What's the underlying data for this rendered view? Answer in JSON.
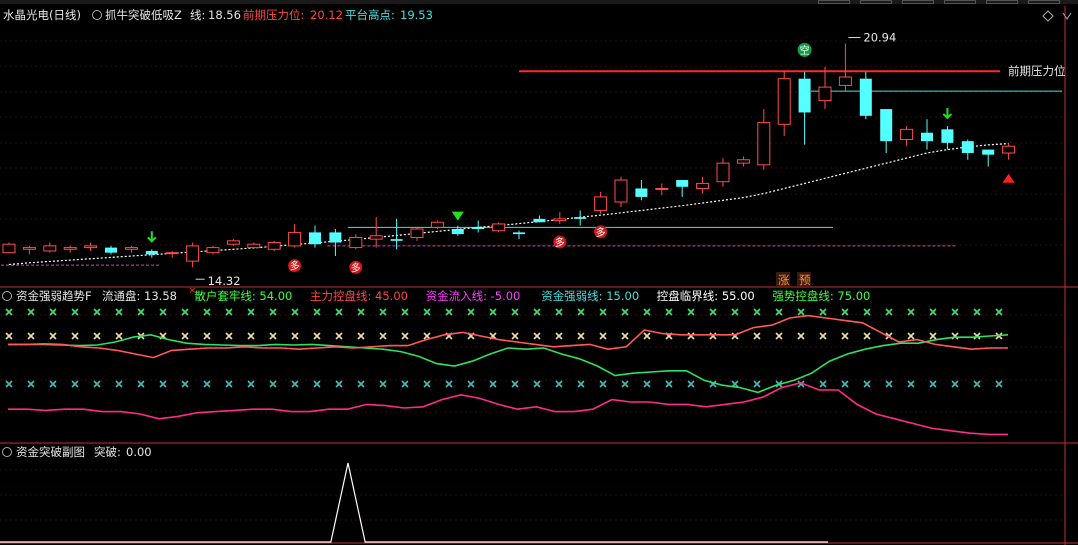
{
  "main": {
    "stock": "水晶光电(日线)",
    "indicator": "抓牛突破低吸Z",
    "line_label": "线:",
    "line_value": "18.56",
    "resist_label": "前期压力位:",
    "resist_value": "20.12",
    "platform_label": "平台高点:",
    "platform_value": "19.53",
    "resist_line_text": "前期压力位",
    "high_text": "20.94",
    "low_text": "14.32",
    "tag_duo": "多",
    "tag_kong": "空",
    "tag_zhang": "涨",
    "tag_yu": "预"
  },
  "sub1": {
    "title": "资金强弱趋势F",
    "items": [
      {
        "label": "流通盘:",
        "value": "13.58",
        "color": "#e6e6e6"
      },
      {
        "label": "散户套牢线:",
        "value": "54.00",
        "color": "#3cff3c"
      },
      {
        "label": "主力控盘线:",
        "value": "45.00",
        "color": "#ff4444"
      },
      {
        "label": "资金流入线:",
        "value": "-5.00",
        "color": "#ff3cff"
      },
      {
        "label": "资金强弱线:",
        "value": "15.00",
        "color": "#40e0e0"
      },
      {
        "label": "控盘临界线:",
        "value": "55.00",
        "color": "#ffffff"
      },
      {
        "label": "强势控盘线:",
        "value": "75.00",
        "color": "#3cff3c"
      }
    ]
  },
  "sub2": {
    "title": "资金突破副图",
    "label": "突破:",
    "value": "0.00"
  },
  "colors": {
    "up": "#ff4b4b",
    "down": "#54ffff",
    "resist": "#ff2b2b",
    "platform": "#40e0e0",
    "ma": "#ffffff",
    "sanhu": "#30e060",
    "zhuli": "#ff5a5a",
    "inflow": "#ff2b8a"
  },
  "chart_data": [
    {
      "type": "candlestick",
      "x": [
        0,
        1,
        2,
        3,
        4,
        5,
        6,
        7,
        8,
        9,
        10,
        11,
        12,
        13,
        14,
        15,
        16,
        17,
        18,
        19,
        20,
        21,
        22,
        23,
        24,
        25,
        26,
        27,
        28,
        29,
        30,
        31,
        32,
        33,
        34,
        35,
        36,
        37,
        38,
        39,
        40,
        41,
        42,
        43,
        44,
        45,
        46,
        47,
        48,
        49
      ],
      "open": [
        14.75,
        14.85,
        14.8,
        14.85,
        14.9,
        14.9,
        14.85,
        14.8,
        14.75,
        14.5,
        14.75,
        15.0,
        14.9,
        14.85,
        14.95,
        15.35,
        15.35,
        14.9,
        15.15,
        15.15,
        15.2,
        15.5,
        15.45,
        15.5,
        15.4,
        15.35,
        15.75,
        15.7,
        15.8,
        16.0,
        16.25,
        16.65,
        16.65,
        16.9,
        16.65,
        16.85,
        17.4,
        17.35,
        18.55,
        19.9,
        19.25,
        19.7,
        19.9,
        19.0,
        18.1,
        18.3,
        18.4,
        18.05,
        17.8,
        17.7
      ],
      "close": [
        15.0,
        14.9,
        14.95,
        14.9,
        14.95,
        14.75,
        14.9,
        14.7,
        14.75,
        14.95,
        14.9,
        15.1,
        15.0,
        15.05,
        15.35,
        15.0,
        15.05,
        15.2,
        15.25,
        15.1,
        15.45,
        15.65,
        15.3,
        15.45,
        15.6,
        15.3,
        15.65,
        15.75,
        15.75,
        16.4,
        16.9,
        16.4,
        16.65,
        16.7,
        16.8,
        17.4,
        17.5,
        18.6,
        19.9,
        18.9,
        19.65,
        19.95,
        18.8,
        18.05,
        18.4,
        18.05,
        18.0,
        17.7,
        17.65,
        17.9
      ],
      "high": [
        15.05,
        14.95,
        15.05,
        14.95,
        15.05,
        14.95,
        14.95,
        14.85,
        14.8,
        15.05,
        14.95,
        15.15,
        15.05,
        15.1,
        15.6,
        15.55,
        15.45,
        15.3,
        15.8,
        15.75,
        15.5,
        15.7,
        15.55,
        15.7,
        15.65,
        15.4,
        15.85,
        15.95,
        16.0,
        16.55,
        17.0,
        16.9,
        16.8,
        16.85,
        17.0,
        17.55,
        17.6,
        19.0,
        20.12,
        20.1,
        20.25,
        20.94,
        20.1,
        18.3,
        18.5,
        18.7,
        18.5,
        18.1,
        17.8,
        18.0
      ],
      "low": [
        14.75,
        14.7,
        14.75,
        14.75,
        14.8,
        14.7,
        14.75,
        14.6,
        14.6,
        14.32,
        14.7,
        14.95,
        14.85,
        14.8,
        14.9,
        14.9,
        14.65,
        14.85,
        14.9,
        14.85,
        15.1,
        15.45,
        15.25,
        15.35,
        15.35,
        15.15,
        15.65,
        15.6,
        15.55,
        15.9,
        16.1,
        16.3,
        16.45,
        16.4,
        16.5,
        16.7,
        17.3,
        17.2,
        18.2,
        17.95,
        19.0,
        19.55,
        18.7,
        17.7,
        17.9,
        17.8,
        17.8,
        17.5,
        17.3,
        17.5
      ],
      "ma": [
        14.4,
        14.45,
        14.49,
        14.53,
        14.57,
        14.61,
        14.65,
        14.69,
        14.73,
        14.77,
        14.81,
        14.85,
        14.89,
        14.94,
        14.99,
        15.04,
        15.09,
        15.14,
        15.2,
        15.26,
        15.32,
        15.38,
        15.44,
        15.5,
        15.55,
        15.61,
        15.67,
        15.73,
        15.8,
        15.86,
        15.93,
        16.0,
        16.07,
        16.14,
        16.22,
        16.3,
        16.38,
        16.5,
        16.65,
        16.8,
        16.95,
        17.1,
        17.25,
        17.4,
        17.55,
        17.7,
        17.8,
        17.88,
        17.94,
        17.98
      ],
      "resist_line": {
        "value": 20.12,
        "from": 25,
        "to": 49
      },
      "platform_line_1": {
        "value": 19.53,
        "from": 40,
        "to": 49
      },
      "platform_line_2": {
        "value": 15.5,
        "from": 17,
        "to": 40
      },
      "magenta_line_1": {
        "value": 14.38,
        "from": 0,
        "to": 7
      },
      "magenta_line_2": {
        "value": 14.95,
        "from": 16,
        "to": 46
      },
      "duo_marks": [
        14,
        17,
        27,
        29
      ],
      "green_arrows": [
        7,
        46
      ],
      "green_tri": [
        22
      ],
      "red_tri": [
        49
      ],
      "kong_mark": [
        39
      ],
      "high_index": 41,
      "low_index": 9,
      "ylim": [
        14.0,
        21.4
      ]
    },
    {
      "type": "line",
      "x": [
        0,
        1,
        2,
        3,
        4,
        5,
        6,
        7,
        8,
        9,
        10,
        11,
        12,
        13,
        14,
        15,
        16,
        17,
        18,
        19,
        20,
        21,
        22,
        23,
        24,
        25,
        26,
        27,
        28,
        29,
        30,
        31,
        32,
        33,
        34,
        35,
        36,
        37,
        38,
        39,
        40,
        41,
        42,
        43,
        44,
        45,
        46,
        47,
        48,
        49
      ],
      "series": [
        {
          "name": "散户套牢线",
          "values": [
            48,
            48,
            48,
            47.5,
            47,
            47.5,
            50,
            54,
            56,
            52,
            49,
            48,
            47.5,
            47,
            47,
            48,
            47.5,
            48,
            47,
            46,
            45,
            44,
            42,
            38,
            32,
            30,
            34,
            40,
            45,
            44,
            45,
            40,
            36,
            30,
            22,
            24,
            25,
            26,
            26,
            18,
            14,
            12,
            8,
            14,
            18,
            24,
            34,
            40,
            44,
            47,
            49,
            49,
            52,
            54,
            54,
            55,
            56
          ]
        },
        {
          "name": "主力控盘线",
          "values": [
            48,
            48,
            48.5,
            48,
            46,
            45,
            43,
            40,
            37,
            43,
            44,
            45,
            45,
            46,
            45,
            45,
            44,
            45,
            46,
            45,
            46,
            47,
            47,
            52,
            56,
            58,
            55,
            52,
            50,
            48,
            46,
            47,
            48,
            44,
            46,
            60,
            57,
            56,
            56,
            56,
            56,
            62,
            64,
            70,
            72,
            70,
            68,
            66,
            58,
            50,
            52,
            48,
            46,
            44,
            45,
            45
          ]
        },
        {
          "name": "资金流入线",
          "values": [
            -6,
            -6,
            -7,
            -6,
            -6,
            -8,
            -8,
            -10,
            -14,
            -12,
            -9,
            -8,
            -7,
            -6,
            -6,
            -8,
            -8,
            -6,
            -6,
            -2,
            -3,
            -5,
            -4,
            2,
            6,
            3,
            -2,
            -6,
            -4,
            -8,
            -8,
            -6,
            2,
            0,
            0,
            -2,
            -2,
            -4,
            -2,
            0,
            4,
            12,
            16,
            10,
            10,
            -2,
            -10,
            -14,
            -18,
            -22,
            -24,
            -26,
            -27,
            -27
          ]
        }
      ],
      "ref_lines": [
        75,
        55,
        15
      ],
      "ylim": [
        -30,
        85
      ]
    },
    {
      "type": "line",
      "series": [
        {
          "name": "突破",
          "values": [
            0,
            0,
            0,
            0,
            0,
            0,
            0,
            0,
            0,
            0,
            0,
            0,
            0,
            0,
            0,
            0,
            0,
            0,
            0,
            0,
            0,
            1,
            0,
            0,
            0,
            0,
            0,
            0,
            0,
            0,
            0,
            0,
            0,
            0,
            0,
            0,
            0,
            0,
            0,
            0,
            0,
            0,
            0,
            0,
            0,
            0,
            0,
            0,
            0,
            0
          ]
        }
      ],
      "ylim": [
        0,
        1
      ]
    }
  ]
}
